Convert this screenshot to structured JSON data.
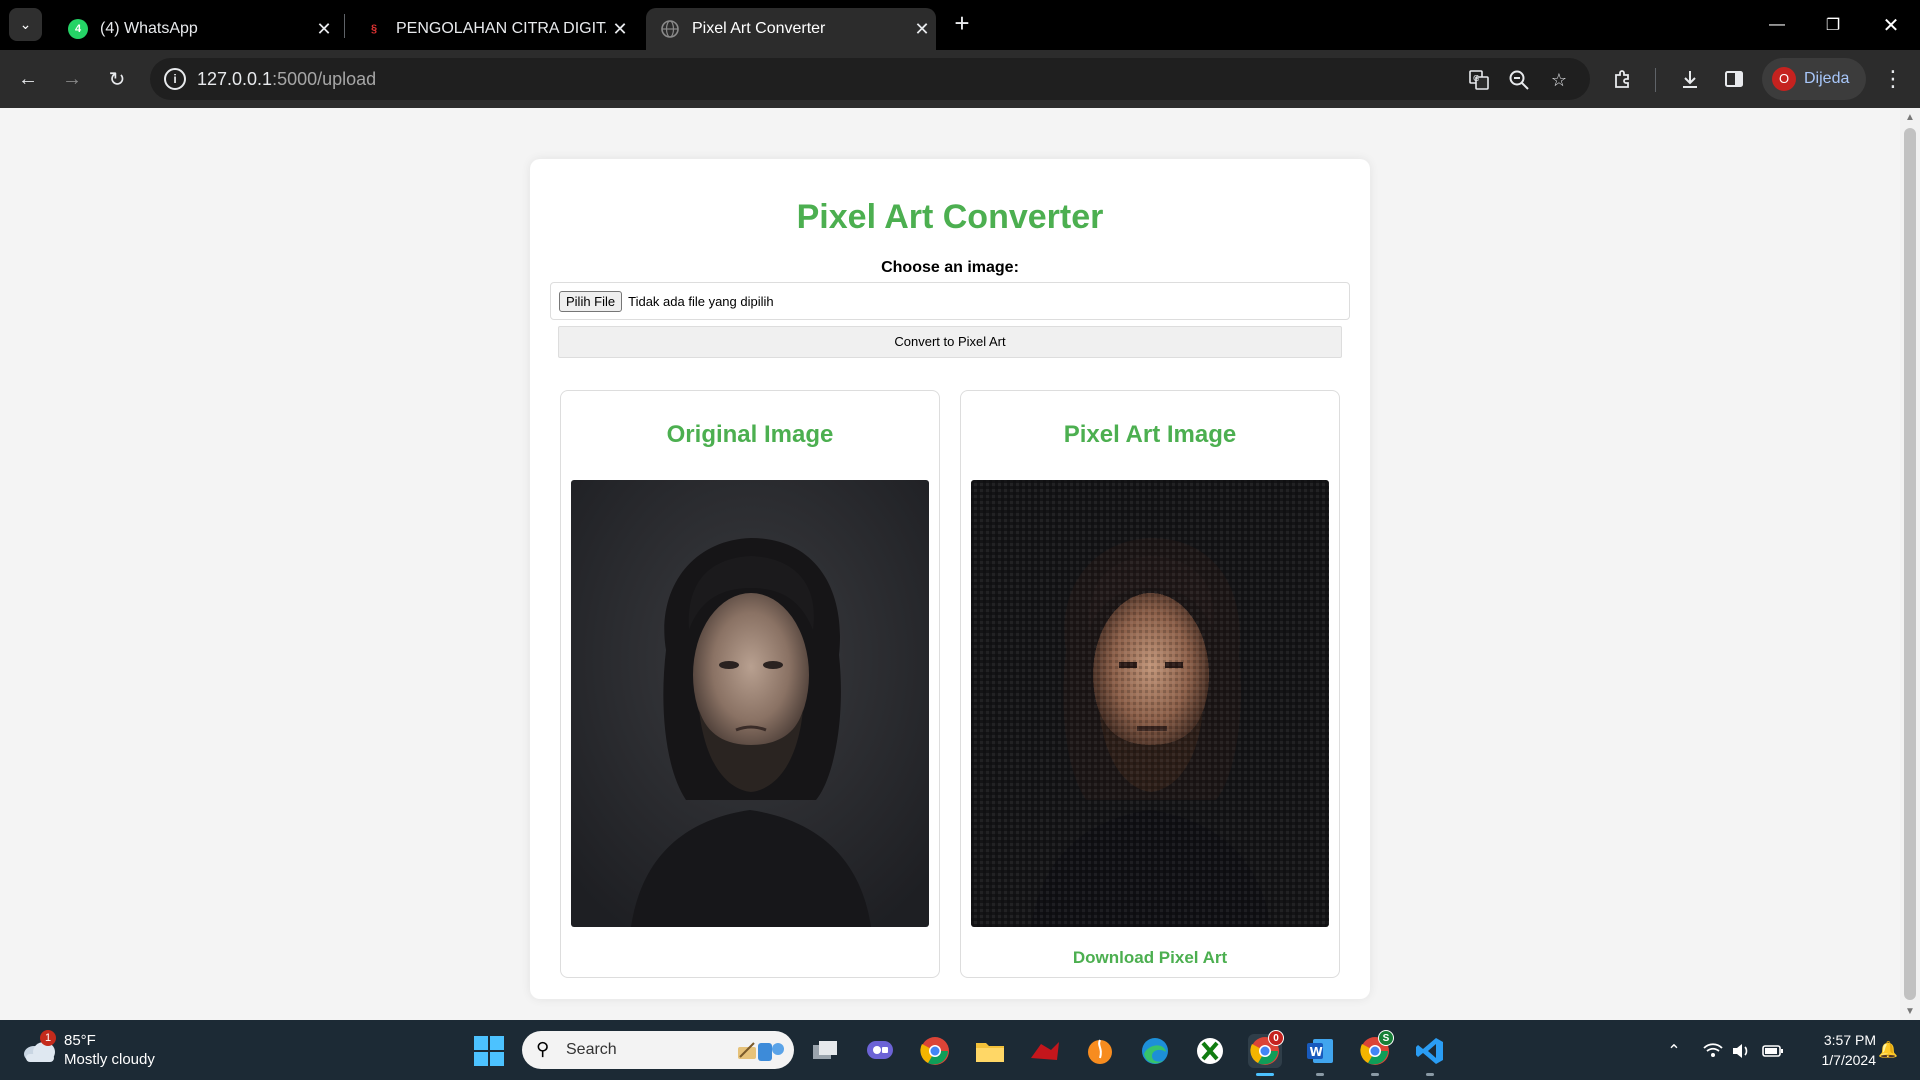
{
  "browser": {
    "tabs": [
      {
        "title": "(4) WhatsApp",
        "active": false,
        "favicon": "whatsapp-icon",
        "badge": "4"
      },
      {
        "title": "PENGOLAHAN CITRA DIGITAL -",
        "active": false,
        "favicon": "site-logo-icon"
      },
      {
        "title": "Pixel Art Converter",
        "active": true,
        "favicon": "globe-icon"
      }
    ],
    "url_host": "127.0.0.1",
    "url_rest": ":5000/upload",
    "profile_initial": "O",
    "profile_name": "Dijeda"
  },
  "page": {
    "title": "Pixel Art Converter",
    "choose_label": "Choose an image:",
    "file_button": "Pilih File",
    "file_status": "Tidak ada file yang dipilih",
    "convert_button": "Convert to Pixel Art",
    "original_title": "Original Image",
    "pixel_title": "Pixel Art Image",
    "download_link": "Download Pixel Art"
  },
  "taskbar": {
    "weather_badge": "1",
    "weather_temp": "85°F",
    "weather_condition": "Mostly cloudy",
    "search_label": "Search",
    "time": "3:57 PM",
    "date": "1/7/2024",
    "chrome_badge": "0",
    "chrome_alt_badge": "S"
  },
  "colors": {
    "accent_green": "#4caf50",
    "tabstrip": "#000000",
    "toolbar": "#2c2c2c",
    "taskbar": "#1c2a35"
  }
}
